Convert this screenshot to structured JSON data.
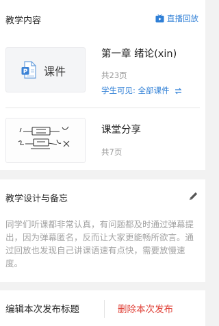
{
  "teaching": {
    "title": "教学内容",
    "replay_label": "直播回放",
    "items": [
      {
        "thumb_label": "课件",
        "title": "第一章 绪论(xin)",
        "meta": "共23页",
        "visibility": "学生可见: 全部课件"
      },
      {
        "title": "课堂分享",
        "meta": "共7页"
      }
    ]
  },
  "design": {
    "title": "教学设计与备忘",
    "memo": "同学们听课都非常认真，有问题都及时通过弹幕提出，因为弹幕匿名，反而让大家更能畅所欲言。通过回放也发现自己讲课语速有点快，需要放慢速度。"
  },
  "actions": {
    "edit_title": "编辑本次发布标题",
    "delete": "删除本次发布"
  },
  "colors": {
    "accent": "#2f7fd6",
    "danger": "#e0443b",
    "muted": "#9a9a9a",
    "background": "#f2f2f2"
  },
  "icons": {
    "replay": "tv-play-icon",
    "courseware": "ppt-document-icon",
    "visibility_toggle": "swap-arrows-icon",
    "edit": "pencil-icon"
  }
}
